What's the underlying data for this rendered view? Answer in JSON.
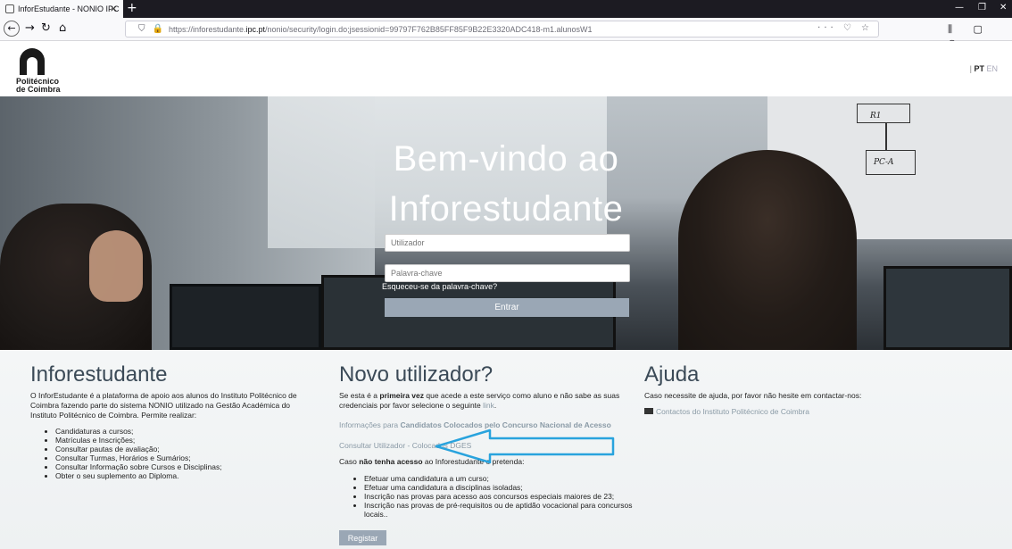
{
  "browser": {
    "tab_title": "InforEstudante - NONIO IPC",
    "tab_close": "×",
    "new_tab": "+",
    "url_prefix": "https://inforestudante.",
    "url_domain": "ipc.pt",
    "url_suffix": "/nonio/security/login.do;jsessionid=99797F762B85FF85F9B22E3320ADC418-m1.alunosW1",
    "url_right_icons": "··· ♡ ☆",
    "toolbar_right_icons": "⫼ ▢ ◉ ≡"
  },
  "header": {
    "logo_line1": "Politécnico",
    "logo_line2": "de Coimbra",
    "lang_sep": "|",
    "lang_pt": "PT",
    "lang_en": "EN"
  },
  "hero": {
    "title_line1": "Bem-vindo ao",
    "title_line2": "Inforestudante",
    "user_placeholder": "Utilizador",
    "password_placeholder": "Palavra-chave",
    "forgot_link": "Esqueceu-se da palavra-chave?",
    "login_button": "Entrar",
    "whiteboard_text1": "R1",
    "whiteboard_text2": "PC-A"
  },
  "info": {
    "title": "Inforestudante",
    "intro": "O InforEstudante é a plataforma de apoio aos alunos do Instituto Politécnico de Coimbra fazendo parte do sistema NONIO utilizado na Gestão Académica do Instituto Politécnico de Coimbra. Permite realizar:",
    "items": [
      "Candidaturas a cursos;",
      "Matrículas e Inscrições;",
      "Consultar pautas de avaliação;",
      "Consultar Turmas, Horários e Sumários;",
      "Consultar Informação sobre Cursos e Disciplinas;",
      "Obter o seu suplemento ao Diploma."
    ]
  },
  "new_user": {
    "title": "Novo utilizador?",
    "p1_pre": "Se esta é a ",
    "p1_bold": "primeira vez",
    "p1_post": " que acede a este serviço como aluno e não sabe as suas credenciais por favor selecione o seguinte ",
    "p1_link": "link",
    "p1_end": ".",
    "candidatos_pre": "Informações para ",
    "candidatos_bold": "Candidatos Colocados pelo Concurso Nacional de Acesso",
    "consultar_link": "Consultar Utilizador - Colocados DGES",
    "p2_pre": "Caso ",
    "p2_bold": "não tenha acesso",
    "p2_post": " ao Inforestudante e pretenda:",
    "items": [
      "Efetuar uma candidatura a um curso;",
      "Efetuar uma candidatura a disciplinas isoladas;",
      "Inscrição nas provas para acesso aos concursos especiais maiores de 23;",
      "Inscrição nas provas de pré-requisitos ou de aptidão vocacional para concursos locais.."
    ],
    "register_button": "Registar"
  },
  "help": {
    "title": "Ajuda",
    "text": "Caso necessite de ajuda, por favor não hesite em contactar-nos:",
    "contact_link": "Contactos do Instituto Politécnico de Coimbra"
  },
  "colors": {
    "accent_blue": "#29a3dd",
    "button": "#9aa7b5",
    "heading": "#3b4a57"
  }
}
